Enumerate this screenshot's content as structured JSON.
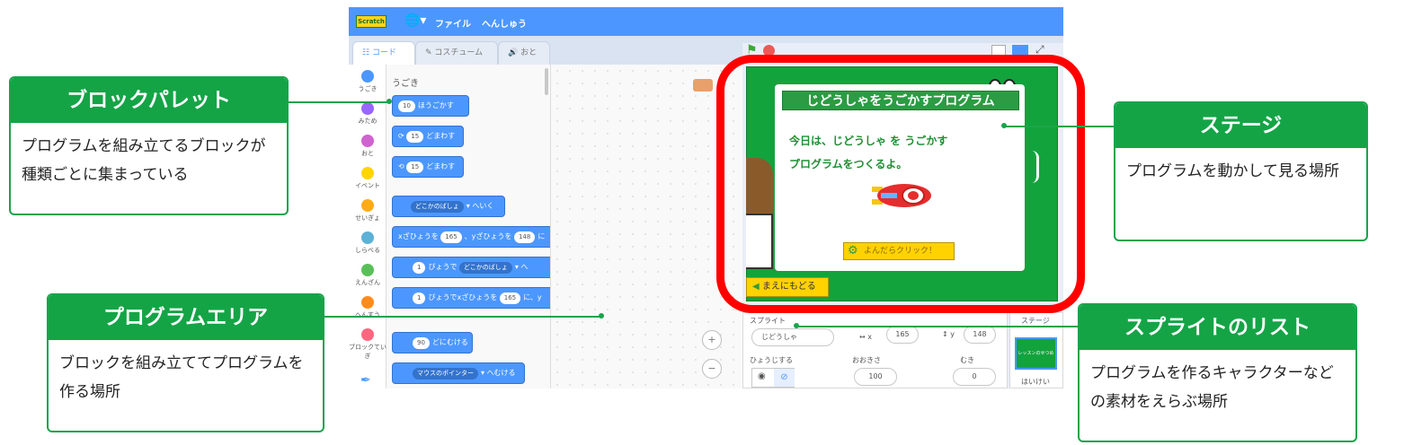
{
  "callouts": {
    "palette": {
      "title": "ブロックパレット",
      "line1": "プログラムを組み立てるブロックが",
      "line2": "種類ごとに集まっている"
    },
    "program": {
      "title": "プログラムエリア",
      "line1": "ブロックを組み立ててプログラムを",
      "line2": "作る場所"
    },
    "stage": {
      "title": "ステージ",
      "line1": "プログラムを動かして見る場所"
    },
    "sprites": {
      "title": "スプライトのリスト",
      "line1": "プログラムを作るキャラクターなど",
      "line2": "の素材をえらぶ場所"
    }
  },
  "editor": {
    "menu": {
      "logo": "Scratch",
      "file": "ファイル",
      "edit": "へんしゅう"
    },
    "tabs": {
      "code": "コード",
      "costume": "コスチューム",
      "sound": "おと"
    },
    "categories": [
      {
        "label": "うごき",
        "color": "#4c97ff"
      },
      {
        "label": "みため",
        "color": "#9966ff"
      },
      {
        "label": "おと",
        "color": "#cf63cf"
      },
      {
        "label": "イベント",
        "color": "#ffd500"
      },
      {
        "label": "せいぎょ",
        "color": "#ffab19"
      },
      {
        "label": "しらべる",
        "color": "#5cb1d6"
      },
      {
        "label": "えんざん",
        "color": "#59c059"
      },
      {
        "label": "へんすう",
        "color": "#ff8c1a"
      },
      {
        "label": "ブロックていぎ",
        "color": "#ff6680"
      }
    ],
    "palette_title": "うごき",
    "blocks": {
      "move": {
        "n": "10",
        "t": "ほうごかす"
      },
      "turn_r": {
        "n": "15",
        "t": "どまわす"
      },
      "turn_l": {
        "n": "15",
        "t": "どまわす"
      },
      "goto": {
        "d": "どこかのばしょ",
        "t": "へいく"
      },
      "gotoxy": {
        "a": "xざひょうを",
        "x": "165",
        "b": "、yざひょうを",
        "y": "148",
        "c": "に"
      },
      "glide": {
        "n": "1",
        "a": "びょうで",
        "d": "どこかのばしょ",
        "c": "へ"
      },
      "glidex": {
        "n": "1",
        "a": "びょうでxざひょうを",
        "x": "165",
        "c": "に、y"
      },
      "point": {
        "n": "90",
        "t": "どにむける"
      },
      "towards": {
        "d": "マウスのポインター",
        "t": "へむける"
      }
    },
    "stage": {
      "title": "じどうしゃをうごかすプログラム",
      "line1": "今日は、じどうしゃ を うごかす",
      "line2": "プログラムをつくるよ。",
      "click": "よんだらクリック！",
      "back": "まえにもどる"
    },
    "sprite": {
      "sprite_label": "スプライト",
      "name": "じどうしゃ",
      "x_label": "x",
      "x_val": "165",
      "y_label": "y",
      "y_val": "148",
      "show_label": "ひょうじする",
      "size_label": "おおきさ",
      "size_val": "100",
      "dir_label": "むき",
      "dir_val": "0"
    },
    "stage_panel": {
      "label": "ステージ",
      "thumb": "レッスンのせつめい",
      "bg_label": "はいけい"
    }
  }
}
